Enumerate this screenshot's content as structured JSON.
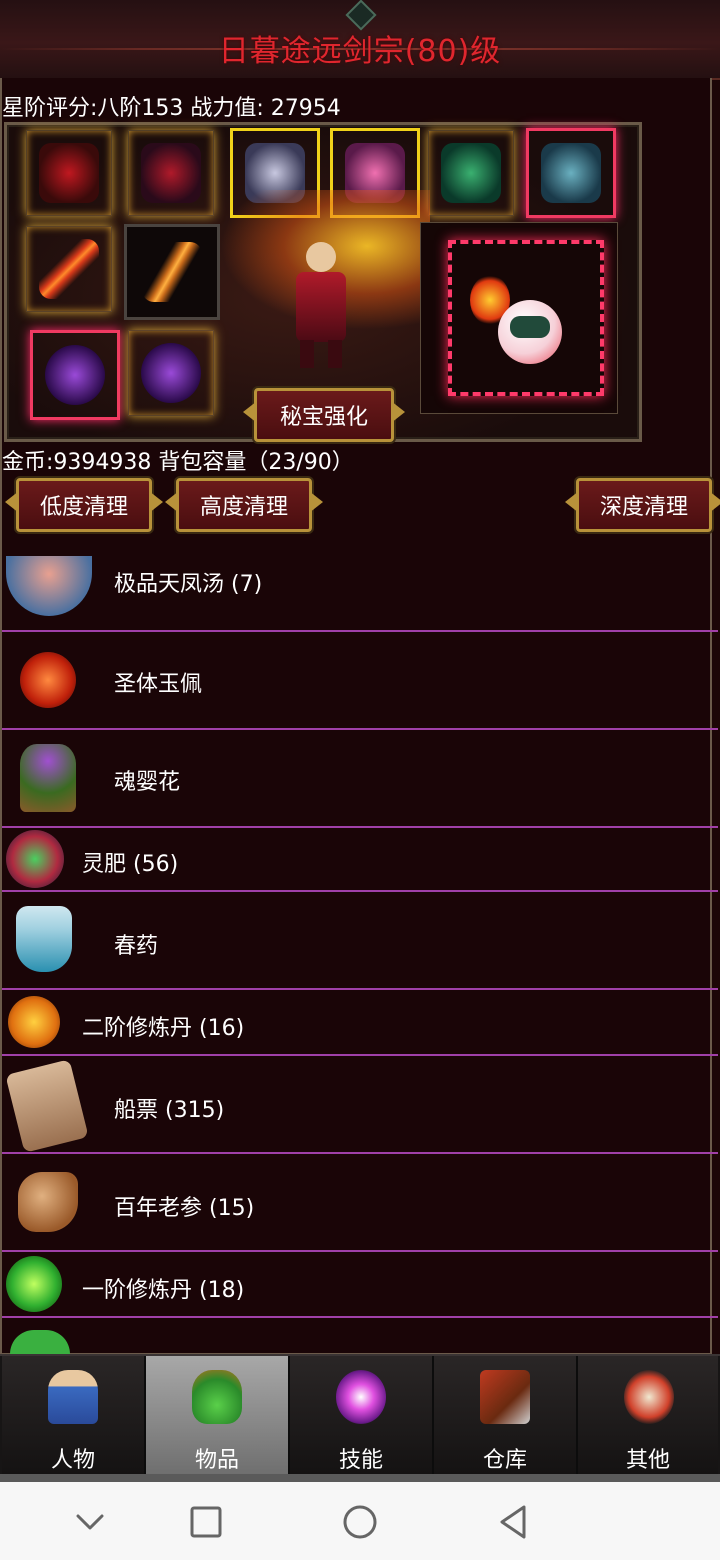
{
  "header": {
    "title": "日暮途远剑宗(80)级"
  },
  "stats": {
    "line": "星阶评分:八阶153 战力值: 27954"
  },
  "equipment": {
    "slots": [
      {
        "icon": "helmet-icon"
      },
      {
        "icon": "armor-icon"
      },
      {
        "icon": "necklace-icon"
      },
      {
        "icon": "feather-charm-icon"
      },
      {
        "icon": "jade-beast-icon"
      },
      {
        "icon": "gauntlet-icon"
      },
      {
        "icon": "sword-icon"
      },
      {
        "icon": "dagger-icon"
      },
      {
        "icon": "purple-ring-icon"
      },
      {
        "icon": "purple-ring-icon"
      }
    ],
    "enhance_button": "秘宝强化"
  },
  "inventory_info": "金币:9394938 背包容量（23/90）",
  "clean_buttons": {
    "low": "低度清理",
    "high": "高度清理",
    "deep": "深度清理"
  },
  "items": [
    {
      "label": "极品天凤汤 (7)",
      "icon": "soup-bowl-icon",
      "color": "#c07058"
    },
    {
      "label": "圣体玉佩",
      "icon": "fire-orb-icon",
      "color": "#e8461a"
    },
    {
      "label": "魂婴花",
      "icon": "flower-icon",
      "color": "#7a40a0"
    },
    {
      "label": "灵肥 (56)",
      "icon": "green-orb-icon",
      "color": "#2e8a3a"
    },
    {
      "label": "春药",
      "icon": "potion-bottle-icon",
      "color": "#3aa0c0"
    },
    {
      "label": "二阶修炼丹 (16)",
      "icon": "orange-pill-icon",
      "color": "#f09a18"
    },
    {
      "label": "船票 (315)",
      "icon": "scroll-icon",
      "color": "#b89070"
    },
    {
      "label": "百年老参 (15)",
      "icon": "ginseng-icon",
      "color": "#c08050"
    },
    {
      "label": "一阶修炼丹 (18)",
      "icon": "green-pill-icon",
      "color": "#38c040"
    }
  ],
  "tabs": [
    {
      "label": "人物",
      "icon": "character-icon"
    },
    {
      "label": "物品",
      "icon": "item-bag-icon"
    },
    {
      "label": "技能",
      "icon": "skill-orb-icon"
    },
    {
      "label": "仓库",
      "icon": "warehouse-icon"
    },
    {
      "label": "其他",
      "icon": "other-icon"
    }
  ],
  "colors": {
    "title": "#e0262e",
    "row_divider": "#a040a8",
    "gold_border": "#b8923a"
  }
}
